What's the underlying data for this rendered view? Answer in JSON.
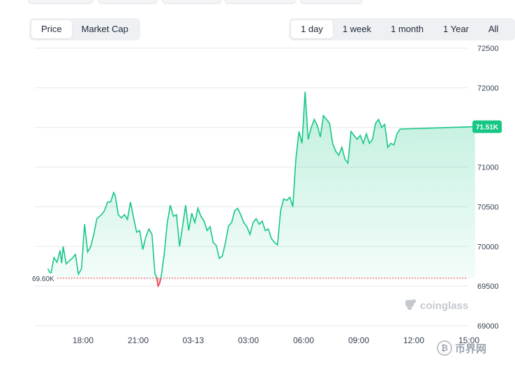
{
  "metric_tabs": [
    {
      "label": "Price",
      "active": true
    },
    {
      "label": "Market Cap",
      "active": false
    }
  ],
  "range_tabs": [
    {
      "label": "1 day",
      "active": true
    },
    {
      "label": "1 week",
      "active": false
    },
    {
      "label": "1 month",
      "active": false
    },
    {
      "label": "1 Year",
      "active": false
    },
    {
      "label": "All",
      "active": false
    }
  ],
  "colors": {
    "up_line": "#16c784",
    "down_line": "#ea3943",
    "reference_line": "#ea3943",
    "grid": "#e5e7eb",
    "price_tag_bg": "#16c784"
  },
  "watermark": {
    "text": "coinglass",
    "icon": "coinglass-logo-icon"
  },
  "watermark2": {
    "text": "币界网",
    "icon": "bitcoin-coin-icon"
  },
  "chart_data": {
    "type": "area",
    "title": "",
    "xlabel": "",
    "ylabel": "",
    "ylim": [
      69000,
      72500
    ],
    "yticks": [
      "72500",
      "72000",
      "71500",
      "71000",
      "70500",
      "70000",
      "69500",
      "69000"
    ],
    "xticks": [
      "18:00",
      "21:00",
      "03-13",
      "03:00",
      "06:00",
      "09:00",
      "12:00",
      "15:00"
    ],
    "xlim": [
      "03-12 16:05",
      "03-13 15:20"
    ],
    "grid": true,
    "reference_line": {
      "value": 69600,
      "label": "69.60K"
    },
    "last_price": {
      "value": 71510,
      "label": "71.51K"
    },
    "series": [
      {
        "values": [
          [
            "03-12 16:05",
            69720
          ],
          [
            "03-12 16:15",
            69650
          ],
          [
            "03-12 16:25",
            69860
          ],
          [
            "03-12 16:35",
            69800
          ],
          [
            "03-12 16:45",
            69950
          ],
          [
            "03-12 16:50",
            69790
          ],
          [
            "03-12 16:55",
            70000
          ],
          [
            "03-12 17:05",
            69780
          ],
          [
            "03-12 17:15",
            69820
          ],
          [
            "03-12 17:25",
            69850
          ],
          [
            "03-12 17:35",
            69900
          ],
          [
            "03-12 17:45",
            69650
          ],
          [
            "03-12 17:55",
            69720
          ],
          [
            "03-12 18:05",
            70280
          ],
          [
            "03-12 18:15",
            69930
          ],
          [
            "03-12 18:25",
            70000
          ],
          [
            "03-12 18:35",
            70150
          ],
          [
            "03-12 18:45",
            70350
          ],
          [
            "03-12 19:00",
            70400
          ],
          [
            "03-12 19:10",
            70450
          ],
          [
            "03-12 19:20",
            70560
          ],
          [
            "03-12 19:30",
            70560
          ],
          [
            "03-12 19:40",
            70680
          ],
          [
            "03-12 19:45",
            70640
          ],
          [
            "03-12 19:55",
            70400
          ],
          [
            "03-12 20:05",
            70360
          ],
          [
            "03-12 20:15",
            70400
          ],
          [
            "03-12 20:25",
            70340
          ],
          [
            "03-12 20:35",
            70560
          ],
          [
            "03-12 20:45",
            70360
          ],
          [
            "03-12 20:55",
            70180
          ],
          [
            "03-12 21:05",
            70200
          ],
          [
            "03-12 21:15",
            69960
          ],
          [
            "03-12 21:25",
            70120
          ],
          [
            "03-12 21:35",
            70220
          ],
          [
            "03-12 21:45",
            70150
          ],
          [
            "03-12 21:55",
            69650
          ],
          [
            "03-12 22:00",
            69620
          ],
          [
            "03-12 22:05",
            69500
          ],
          [
            "03-12 22:10",
            69530
          ],
          [
            "03-12 22:15",
            69620
          ],
          [
            "03-12 22:25",
            69900
          ],
          [
            "03-12 22:35",
            70300
          ],
          [
            "03-12 22:45",
            70520
          ],
          [
            "03-12 22:55",
            70380
          ],
          [
            "03-12 23:05",
            70400
          ],
          [
            "03-12 23:15",
            70000
          ],
          [
            "03-12 23:25",
            70250
          ],
          [
            "03-12 23:35",
            70520
          ],
          [
            "03-12 23:45",
            70200
          ],
          [
            "03-12 23:55",
            70420
          ],
          [
            "03-13 00:05",
            70300
          ],
          [
            "03-13 00:15",
            70480
          ],
          [
            "03-13 00:25",
            70380
          ],
          [
            "03-13 00:35",
            70320
          ],
          [
            "03-13 00:45",
            70200
          ],
          [
            "03-13 00:55",
            70250
          ],
          [
            "03-13 01:05",
            70050
          ],
          [
            "03-13 01:15",
            70010
          ],
          [
            "03-13 01:25",
            69850
          ],
          [
            "03-13 01:35",
            69880
          ],
          [
            "03-13 01:45",
            70050
          ],
          [
            "03-13 01:55",
            70260
          ],
          [
            "03-13 02:05",
            70300
          ],
          [
            "03-13 02:15",
            70450
          ],
          [
            "03-13 02:25",
            70480
          ],
          [
            "03-13 02:35",
            70400
          ],
          [
            "03-13 02:45",
            70300
          ],
          [
            "03-13 02:55",
            70250
          ],
          [
            "03-13 03:05",
            70150
          ],
          [
            "03-13 03:15",
            70300
          ],
          [
            "03-13 03:25",
            70350
          ],
          [
            "03-13 03:35",
            70280
          ],
          [
            "03-13 03:45",
            70320
          ],
          [
            "03-13 03:55",
            70200
          ],
          [
            "03-13 04:05",
            70220
          ],
          [
            "03-13 04:15",
            70100
          ],
          [
            "03-13 04:25",
            70050
          ],
          [
            "03-13 04:35",
            70020
          ],
          [
            "03-13 04:45",
            70450
          ],
          [
            "03-13 04:55",
            70600
          ],
          [
            "03-13 05:05",
            70580
          ],
          [
            "03-13 05:15",
            70620
          ],
          [
            "03-13 05:25",
            70500
          ],
          [
            "03-13 05:35",
            71100
          ],
          [
            "03-13 05:45",
            71450
          ],
          [
            "03-13 05:55",
            71300
          ],
          [
            "03-13 06:05",
            71950
          ],
          [
            "03-13 06:15",
            71350
          ],
          [
            "03-13 06:25",
            71500
          ],
          [
            "03-13 06:35",
            71600
          ],
          [
            "03-13 06:45",
            71520
          ],
          [
            "03-13 06:55",
            71380
          ],
          [
            "03-13 07:05",
            71650
          ],
          [
            "03-13 07:15",
            71600
          ],
          [
            "03-13 07:25",
            71550
          ],
          [
            "03-13 07:35",
            71300
          ],
          [
            "03-13 07:45",
            71200
          ],
          [
            "03-13 07:55",
            71150
          ],
          [
            "03-13 08:05",
            71250
          ],
          [
            "03-13 08:15",
            71100
          ],
          [
            "03-13 08:25",
            71050
          ],
          [
            "03-13 08:35",
            71450
          ],
          [
            "03-13 08:45",
            71400
          ],
          [
            "03-13 08:55",
            71350
          ],
          [
            "03-13 09:05",
            71400
          ],
          [
            "03-13 09:15",
            71300
          ],
          [
            "03-13 09:25",
            71420
          ],
          [
            "03-13 09:35",
            71300
          ],
          [
            "03-13 09:45",
            71350
          ],
          [
            "03-13 09:55",
            71550
          ],
          [
            "03-13 10:05",
            71600
          ],
          [
            "03-13 10:15",
            71500
          ],
          [
            "03-13 10:25",
            71540
          ],
          [
            "03-13 10:35",
            71250
          ],
          [
            "03-13 10:45",
            71300
          ],
          [
            "03-13 10:55",
            71280
          ],
          [
            "03-13 11:05",
            71420
          ],
          [
            "03-13 11:15",
            71480
          ],
          [
            "03-13 15:20",
            71510
          ]
        ]
      }
    ]
  }
}
